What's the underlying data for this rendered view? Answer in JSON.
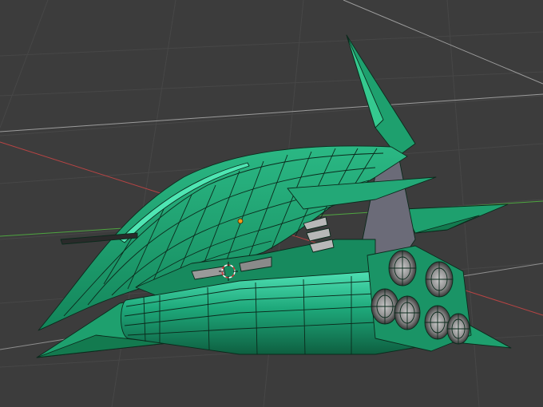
{
  "app": {
    "view": "3d-viewport",
    "shading": "wireframe-over-solid"
  },
  "colors": {
    "background": "#3c3c3c",
    "grid_line": "#4a4a4a",
    "grid_line_light": "#a9a9a9",
    "x_axis": "#c84a4a",
    "y_axis": "#59b24a",
    "mesh_fill": "#1ea06e",
    "mesh_fill_dark": "#137a4f",
    "mesh_highlight": "#35d9a0",
    "mesh_shadow": "#6b6b78",
    "wire": "#0b2a1c",
    "object_origin": "#f39a1a",
    "cursor_3d_a": "#d63a3a",
    "cursor_3d_b": "#ffffff"
  },
  "icons": {
    "cursor": "3d-cursor-icon",
    "origin": "object-origin-icon"
  }
}
